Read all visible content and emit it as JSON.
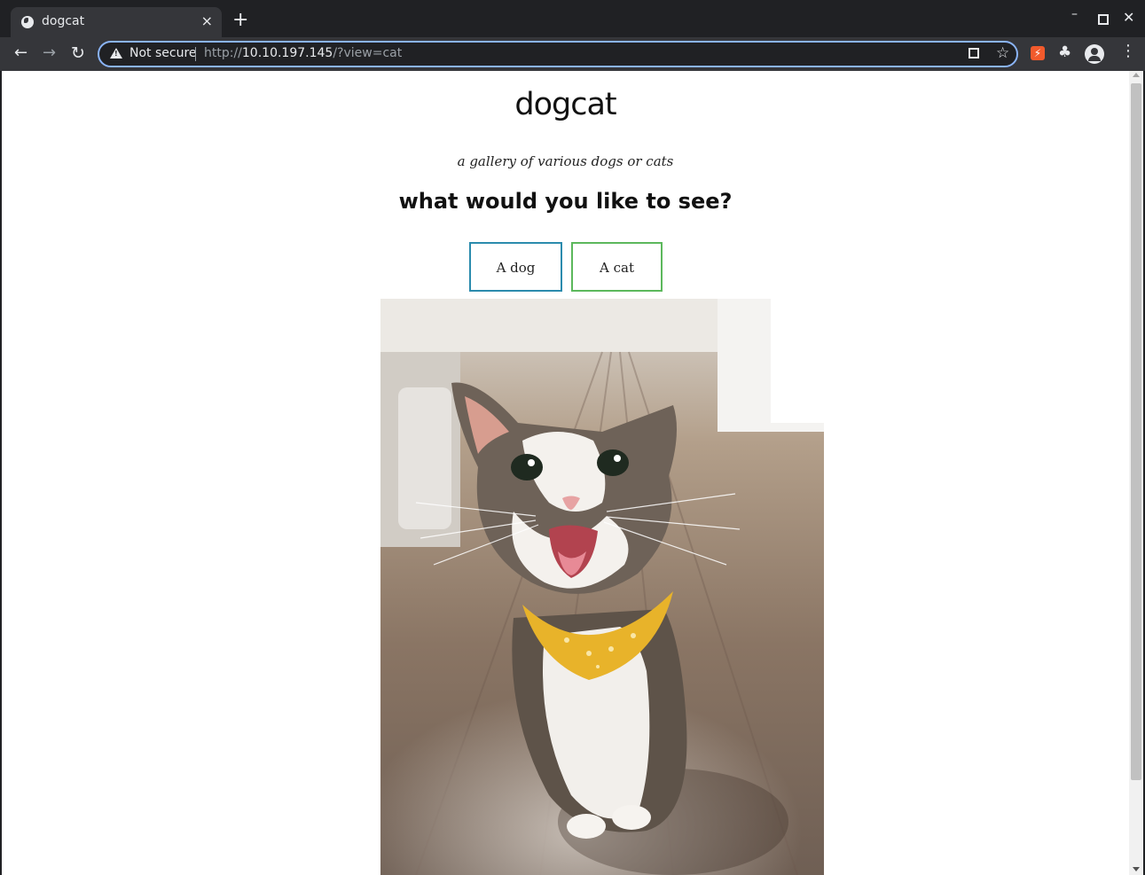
{
  "browser": {
    "tab_title": "dogcat",
    "new_tab_label": "+",
    "close_tab_label": "×",
    "security_label": "Not secure",
    "url_scheme": "http://",
    "url_host": "10.10.197.145",
    "url_path": "/?view=cat",
    "accent_color": "#8ab4f8"
  },
  "page": {
    "title": "dogcat",
    "subtitle": "a gallery of various dogs or cats",
    "question": "what would you like to see?",
    "buttons": {
      "dog_label": "A dog",
      "cat_label": "A cat"
    },
    "image_alt_subject": "cat",
    "dog_button_color": "#2b8bad",
    "cat_button_color": "#5cb85c"
  },
  "icons": {
    "favicon": "globe-icon",
    "back": "arrow-left-icon",
    "forward": "arrow-right-icon",
    "reload": "reload-icon",
    "security": "warning-icon",
    "qr": "qr-code-icon",
    "bookmark": "star-icon",
    "extension": "puzzle-icon",
    "profile": "profile-icon",
    "menu": "kebab-menu-icon"
  }
}
